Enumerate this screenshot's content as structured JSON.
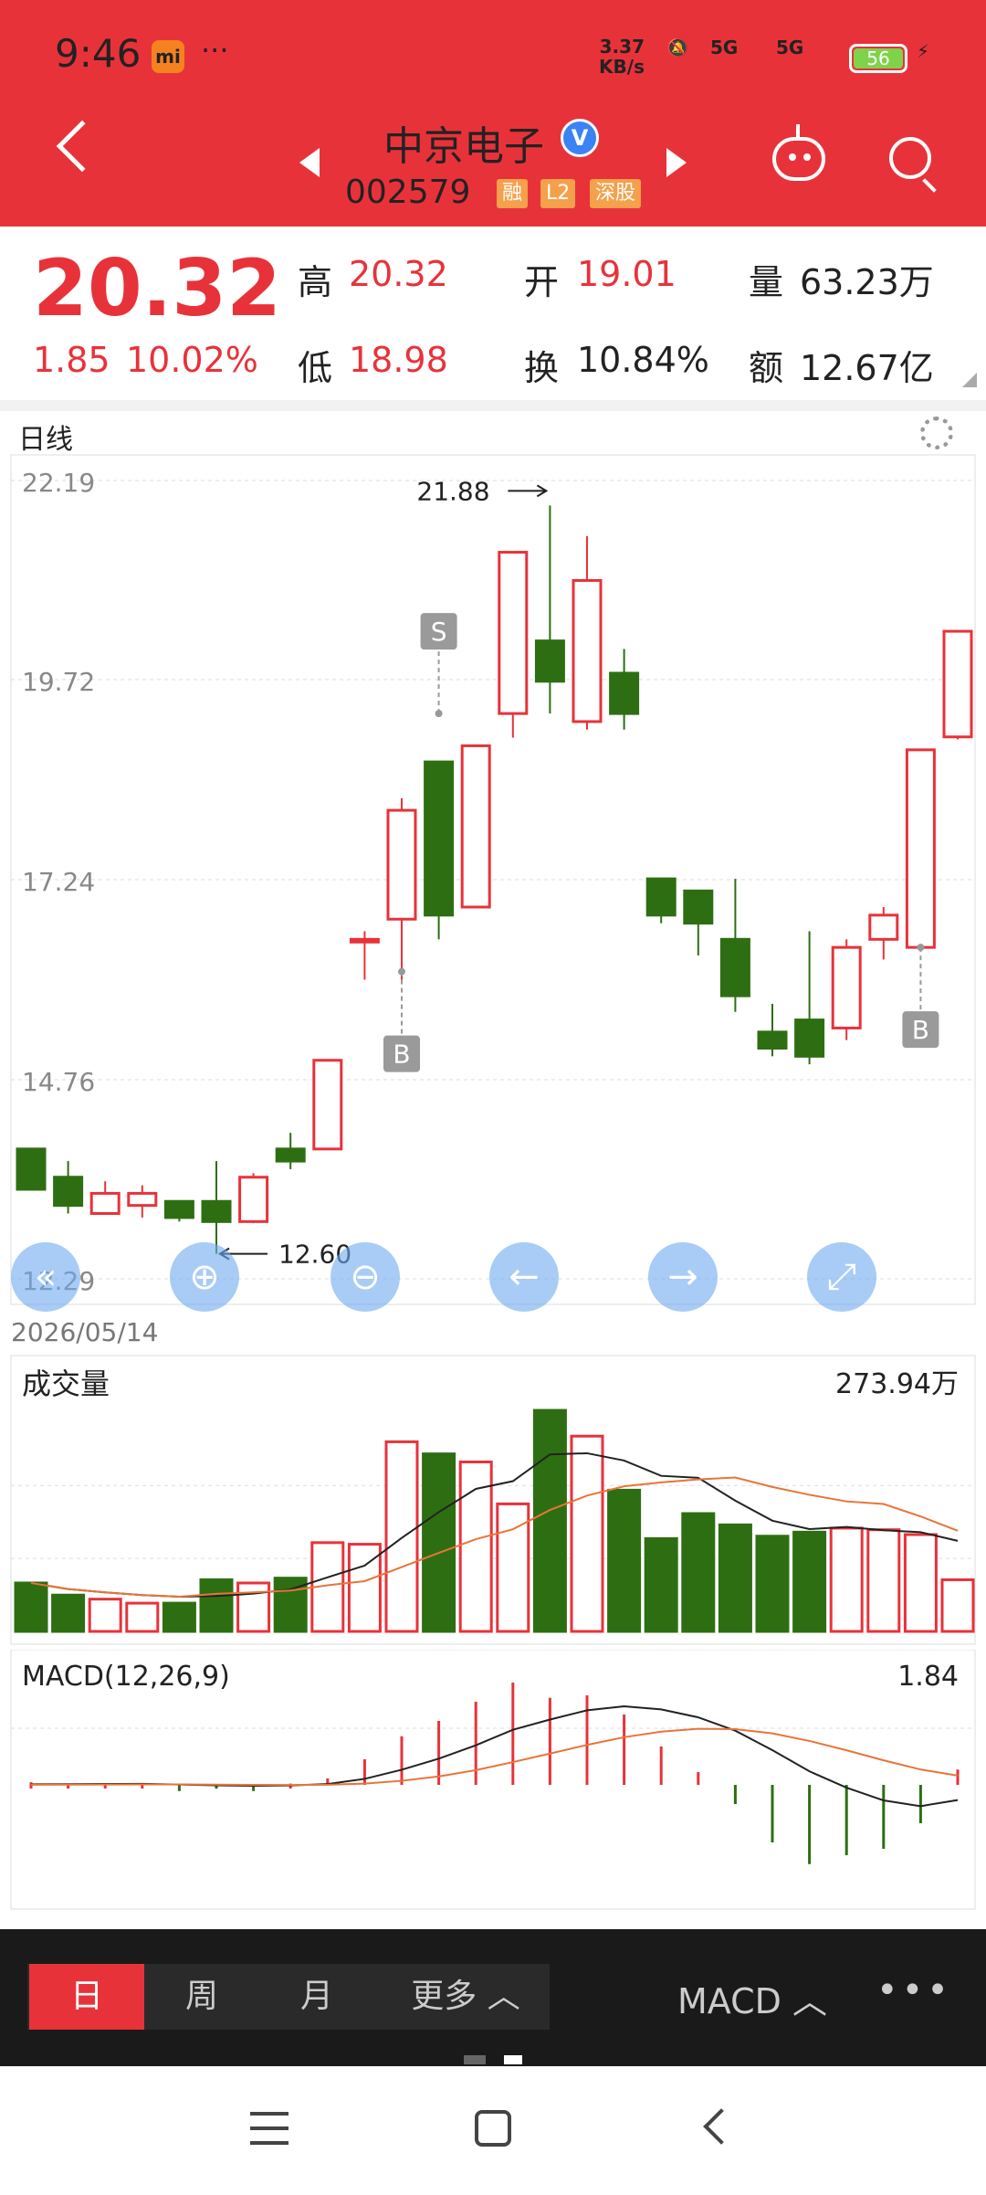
{
  "status": {
    "time": "9:46",
    "mi": "mi",
    "dots": "···",
    "speed_top": "3.37",
    "speed_bottom": "KB/s",
    "sig1": "5G",
    "sig2": "5G",
    "battery": "56"
  },
  "title": {
    "name": "中京电子",
    "verified": "V",
    "code": "002579",
    "tags": [
      "融",
      "L2",
      "深股"
    ]
  },
  "quote": {
    "price": "20.32",
    "change": "1.85",
    "change_pct": "10.02%",
    "high_label": "高",
    "high": "20.32",
    "low_label": "低",
    "low": "18.98",
    "open_label": "开",
    "open": "19.01",
    "turnover_label": "换",
    "turnover": "10.84%",
    "volume_label": "量",
    "volume": "63.23万",
    "amount_label": "额",
    "amount": "12.67亿"
  },
  "kline": {
    "title": "日线",
    "date": "2026/05/14",
    "high_note": "21.88",
    "low_note": "12.60",
    "markers": [
      "S",
      "B",
      "B"
    ]
  },
  "volume": {
    "title": "成交量",
    "max": "273.94万"
  },
  "macd": {
    "title": "MACD(12,26,9)",
    "max": "1.84"
  },
  "bottom": {
    "periods": [
      "日",
      "周",
      "月",
      "更多 ︿"
    ],
    "indicator": "MACD ︿",
    "more": "•••"
  },
  "chart_data": [
    {
      "type": "candlestick",
      "title": "日线",
      "y_ticks": [
        22.19,
        19.72,
        17.24,
        14.76,
        12.29
      ],
      "ylim": [
        12.29,
        22.19
      ],
      "candles": [
        {
          "o": 13.9,
          "h": 13.9,
          "l": 13.4,
          "c": 13.4
        },
        {
          "o": 13.55,
          "h": 13.75,
          "l": 13.1,
          "c": 13.2
        },
        {
          "o": 13.1,
          "h": 13.5,
          "l": 13.1,
          "c": 13.35
        },
        {
          "o": 13.2,
          "h": 13.45,
          "l": 13.05,
          "c": 13.35
        },
        {
          "o": 13.25,
          "h": 13.25,
          "l": 13.0,
          "c": 13.05
        },
        {
          "o": 13.25,
          "h": 13.75,
          "l": 12.6,
          "c": 13.0
        },
        {
          "o": 13.0,
          "h": 13.6,
          "l": 12.98,
          "c": 13.55
        },
        {
          "o": 13.9,
          "h": 14.1,
          "l": 13.65,
          "c": 13.75
        },
        {
          "o": 13.9,
          "h": 15.0,
          "l": 13.9,
          "c": 15.0
        },
        {
          "o": 16.5,
          "h": 16.6,
          "l": 16.0,
          "c": 16.5
        },
        {
          "o": 16.75,
          "h": 18.25,
          "l": 16.0,
          "c": 18.1
        },
        {
          "o": 18.7,
          "h": 18.7,
          "l": 16.5,
          "c": 16.8
        },
        {
          "o": 16.9,
          "h": 18.9,
          "l": 16.9,
          "c": 18.9
        },
        {
          "o": 19.3,
          "h": 21.3,
          "l": 19.0,
          "c": 21.3
        },
        {
          "o": 20.2,
          "h": 21.88,
          "l": 19.3,
          "c": 19.7
        },
        {
          "o": 19.2,
          "h": 21.5,
          "l": 19.1,
          "c": 20.95
        },
        {
          "o": 19.8,
          "h": 20.1,
          "l": 19.1,
          "c": 19.3
        },
        {
          "o": 17.25,
          "h": 17.25,
          "l": 16.7,
          "c": 16.8
        },
        {
          "o": 17.1,
          "h": 17.1,
          "l": 16.3,
          "c": 16.7
        },
        {
          "o": 16.5,
          "h": 17.25,
          "l": 15.6,
          "c": 15.8
        },
        {
          "o": 15.35,
          "h": 15.7,
          "l": 15.05,
          "c": 15.15
        },
        {
          "o": 15.5,
          "h": 16.6,
          "l": 14.95,
          "c": 15.05
        },
        {
          "o": 15.4,
          "h": 16.5,
          "l": 15.25,
          "c": 16.4
        },
        {
          "o": 16.5,
          "h": 16.9,
          "l": 16.25,
          "c": 16.8
        },
        {
          "o": 16.4,
          "h": 18.85,
          "l": 16.4,
          "c": 18.85
        },
        {
          "o": 19.01,
          "h": 20.32,
          "l": 18.98,
          "c": 20.32
        }
      ]
    },
    {
      "type": "bar",
      "title": "成交量",
      "max_label": "273.94万",
      "ylim": [
        0,
        273.94
      ],
      "values": [
        60,
        45,
        40,
        35,
        35,
        64,
        60,
        66,
        110,
        108,
        235,
        220,
        210,
        158,
        273.94,
        242,
        175,
        115,
        146,
        132,
        118,
        123,
        128,
        126,
        120,
        64
      ],
      "colors": [
        "g",
        "g",
        "r",
        "r",
        "g",
        "g",
        "r",
        "g",
        "r",
        "r",
        "r",
        "g",
        "r",
        "r",
        "g",
        "r",
        "g",
        "g",
        "g",
        "g",
        "g",
        "g",
        "r",
        "r",
        "r",
        "r"
      ]
    },
    {
      "type": "bar",
      "title": "MACD(12,26,9)",
      "max_label": "1.84",
      "values": [
        0.02,
        0.01,
        0.01,
        0.01,
        -0.02,
        -0.03,
        -0.02,
        0.01,
        0.05,
        0.2,
        0.38,
        0.5,
        0.65,
        0.8,
        0.68,
        0.7,
        0.55,
        0.3,
        0.1,
        -0.15,
        -0.45,
        -0.62,
        -0.55,
        -0.5,
        -0.3,
        0.12
      ]
    }
  ]
}
